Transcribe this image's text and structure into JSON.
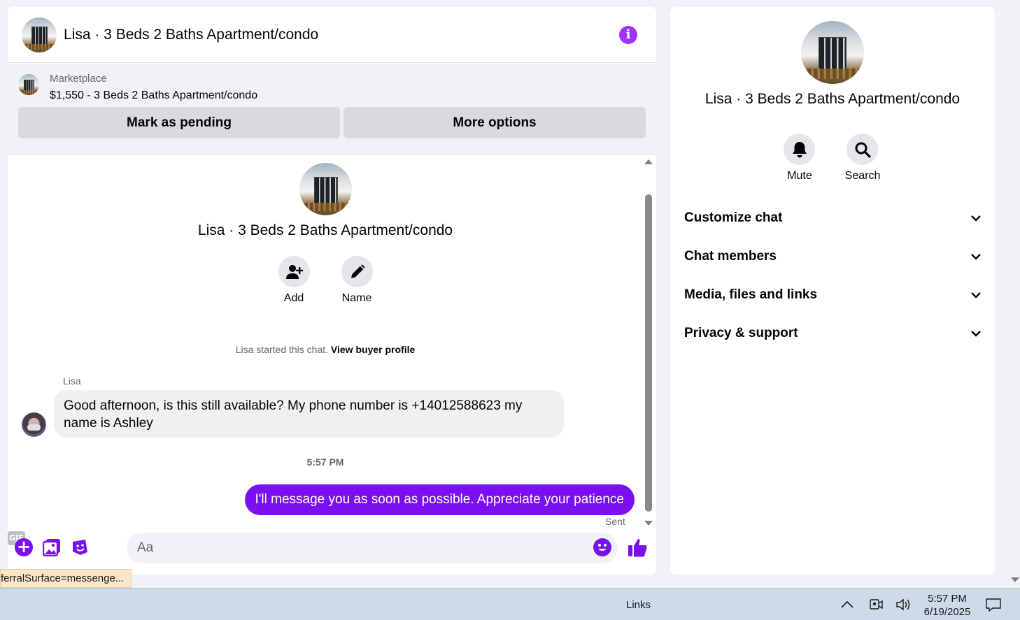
{
  "chat": {
    "header_title": "Lisa · 3 Beds 2 Baths Apartment/condo",
    "marketplace": {
      "label": "Marketplace",
      "listing": "$1,550 - 3 Beds 2 Baths Apartment/condo",
      "pending_button": "Mark as pending",
      "more_button": "More options"
    },
    "intro": {
      "title": "Lisa · 3 Beds 2 Baths Apartment/condo",
      "add_label": "Add",
      "name_label": "Name",
      "started_text": "Lisa started this chat.",
      "profile_link": "View buyer profile"
    },
    "messages": [
      {
        "sender": "Lisa",
        "text": "Good afternoon, is this still available? My phone number is +14012588623 my name is Ashley"
      },
      {
        "timestamp": "5:57 PM"
      },
      {
        "text": "I'll message you as soon as possible. Appreciate your patience",
        "status": "Sent"
      }
    ],
    "composer": {
      "placeholder": "Aa",
      "gif_label": "GIF"
    }
  },
  "info_panel": {
    "title": "Lisa · 3 Beds 2 Baths Apartment/condo",
    "mute_label": "Mute",
    "search_label": "Search",
    "sections": [
      {
        "label": "Customize chat"
      },
      {
        "label": "Chat members"
      },
      {
        "label": "Media, files and links"
      },
      {
        "label": "Privacy & support"
      }
    ]
  },
  "status_url": "ferralSurface=messenge...",
  "taskbar": {
    "links_label": "Links",
    "time": "5:57 PM",
    "date": "6/19/2025"
  },
  "colors": {
    "accent": "#7a10f2",
    "info_icon": "#a033ff",
    "bubble_in": "#f0f0f0",
    "page_bg": "#f0f2f5"
  },
  "icons": [
    "info-icon",
    "user-plus-icon",
    "pencil-icon",
    "plus-icon",
    "image-icon",
    "sticker-icon",
    "gif-icon",
    "emoji-icon",
    "thumbs-up-icon",
    "bell-icon",
    "search-icon",
    "chevron-down-icon",
    "chevron-up-icon",
    "meet-icon",
    "speaker-icon",
    "notification-icon"
  ]
}
